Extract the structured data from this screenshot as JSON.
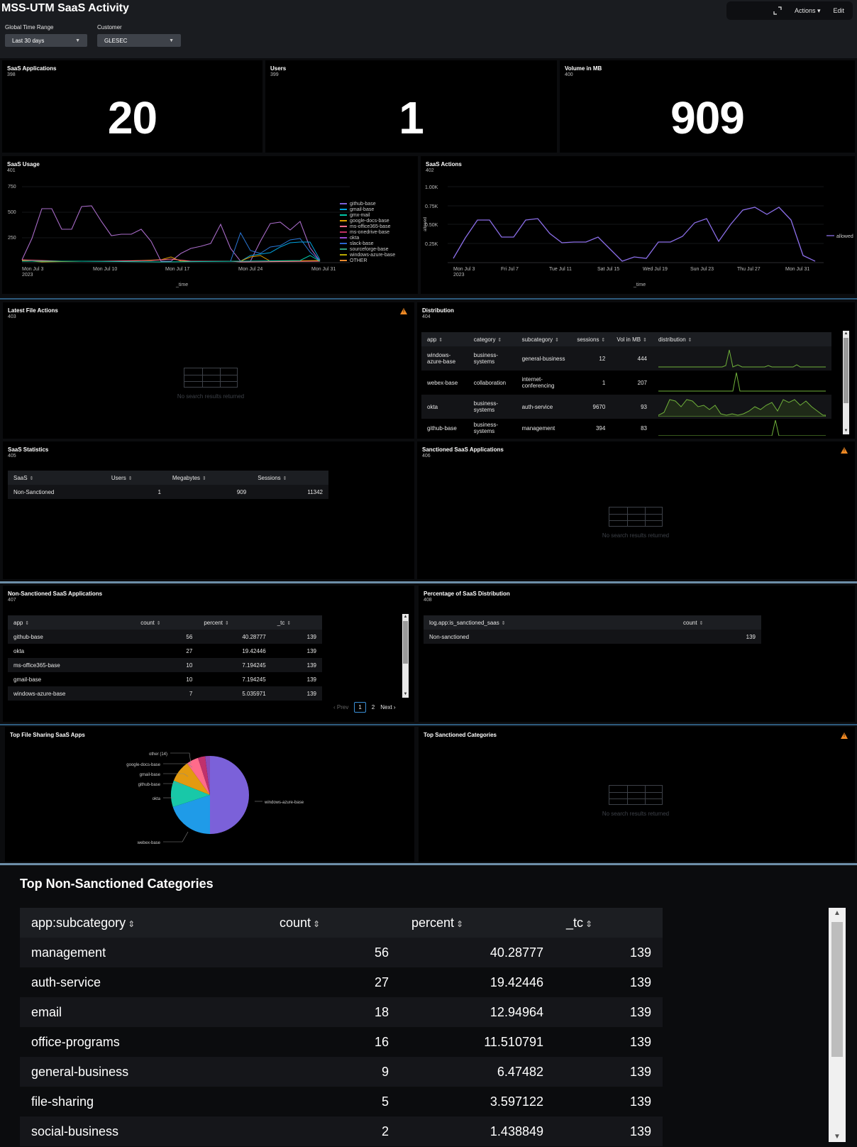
{
  "header": {
    "title": "MSS-UTM SaaS Activity",
    "actions_label": "Actions ▾",
    "edit_label": "Edit",
    "time_label": "Global Time Range",
    "time_value": "Last 30 days",
    "customer_label": "Customer",
    "customer_value": "GLESEC"
  },
  "singles": [
    {
      "title": "SaaS Applications",
      "id": "398",
      "value": "20"
    },
    {
      "title": "Users",
      "id": "399",
      "value": "1"
    },
    {
      "title": "Volume in MB",
      "id": "400",
      "value": "909"
    }
  ],
  "usage": {
    "title": "SaaS Usage",
    "id": "401",
    "y_ticks": [
      "750",
      "500",
      "250"
    ],
    "x_ticks": [
      "Mon Jul 3",
      "Mon Jul 10",
      "Mon Jul 17",
      "Mon Jul 24",
      "Mon Jul 31"
    ],
    "x_year": "2023",
    "x_label": "_time",
    "legend": [
      {
        "name": "github-base",
        "color": "#7b61d9"
      },
      {
        "name": "gmail-base",
        "color": "#00a4e0"
      },
      {
        "name": "gmx-mail",
        "color": "#00c6a8"
      },
      {
        "name": "google-docs-base",
        "color": "#e0a000"
      },
      {
        "name": "ms-office365-base",
        "color": "#ff6b8b"
      },
      {
        "name": "ms-onedrive-base",
        "color": "#c03060"
      },
      {
        "name": "okta",
        "color": "#9a4bd0"
      },
      {
        "name": "slack-base",
        "color": "#2a66d0"
      },
      {
        "name": "sourceforge-base",
        "color": "#30a080"
      },
      {
        "name": "windows-azure-base",
        "color": "#b8a800"
      },
      {
        "name": "OTHER",
        "color": "#e88a30"
      }
    ]
  },
  "actions_chart": {
    "title": "SaaS Actions",
    "id": "402",
    "y_ticks": [
      "1.00K",
      "0.75K",
      "0.50K",
      "0.25K"
    ],
    "y_label": "allowed",
    "x_ticks": [
      "Mon Jul 3",
      "Fri Jul 7",
      "Tue Jul 11",
      "Sat Jul 15",
      "Wed Jul 19",
      "Sun Jul 23",
      "Thu Jul 27",
      "Mon Jul 31"
    ],
    "x_year": "2023",
    "x_label": "_time",
    "legend_name": "allowed"
  },
  "file_actions": {
    "title": "Latest File Actions",
    "id": "403",
    "empty": "No search results returned"
  },
  "distribution": {
    "title": "Distribution",
    "id": "404",
    "columns": [
      "app",
      "category",
      "subcategory",
      "sessions",
      "Vol in MB",
      "distribution"
    ],
    "rows": [
      {
        "app": "windows-azure-base",
        "category": "business-systems",
        "subcategory": "general-business",
        "sessions": "12",
        "vol": "444"
      },
      {
        "app": "webex-base",
        "category": "collaboration",
        "subcategory": "internet-conferencing",
        "sessions": "1",
        "vol": "207"
      },
      {
        "app": "okta",
        "category": "business-systems",
        "subcategory": "auth-service",
        "sessions": "9670",
        "vol": "93"
      },
      {
        "app": "github-base",
        "category": "business-systems",
        "subcategory": "management",
        "sessions": "394",
        "vol": "83"
      }
    ]
  },
  "stats": {
    "title": "SaaS Statistics",
    "id": "405",
    "columns": [
      "SaaS",
      "Users",
      "Megabytes",
      "Sessions"
    ],
    "row": {
      "saas": "Non-Sanctioned",
      "users": "1",
      "mb": "909",
      "sessions": "11342"
    }
  },
  "sanctioned": {
    "title": "Sanctioned SaaS Applications",
    "id": "406",
    "empty": "No search results returned"
  },
  "nonsanctioned": {
    "title": "Non-Sanctioned SaaS Applications",
    "id": "407",
    "columns": [
      "app",
      "count",
      "percent",
      "_tc"
    ],
    "rows": [
      {
        "app": "github-base",
        "count": "56",
        "percent": "40.28777",
        "tc": "139"
      },
      {
        "app": "okta",
        "count": "27",
        "percent": "19.42446",
        "tc": "139"
      },
      {
        "app": "ms-office365-base",
        "count": "10",
        "percent": "7.194245",
        "tc": "139"
      },
      {
        "app": "gmail-base",
        "count": "10",
        "percent": "7.194245",
        "tc": "139"
      },
      {
        "app": "windows-azure-base",
        "count": "7",
        "percent": "5.035971",
        "tc": "139"
      }
    ],
    "pager": {
      "prev": "‹ Prev",
      "p1": "1",
      "p2": "2",
      "next": "Next ›"
    }
  },
  "percentage": {
    "title": "Percentage of SaaS Distribution",
    "id": "408",
    "columns": [
      "log.app:is_sanctioned_saas",
      "count"
    ],
    "row": {
      "name": "Non-sanctioned",
      "count": "139"
    }
  },
  "filesharing": {
    "title": "Top File Sharing SaaS Apps",
    "labels": [
      "other (14)",
      "google-docs-base",
      "gmail-base",
      "github-base",
      "okta",
      "webex-base",
      "windows-azure-base"
    ]
  },
  "chart_data": {
    "type": "pie",
    "categories": [
      "windows-azure-base",
      "webex-base",
      "okta",
      "github-base",
      "gmail-base",
      "google-docs-base",
      "other (14)"
    ],
    "values": [
      50,
      20,
      11,
      9,
      5,
      3,
      2
    ]
  },
  "topsanctioned": {
    "title": "Top Sanctioned Categories",
    "empty": "No search results returned"
  },
  "topnonsanctioned": {
    "title": "Top Non-Sanctioned Categories",
    "columns": [
      "app:subcategory",
      "count",
      "percent",
      "_tc"
    ],
    "rows": [
      {
        "cat": "management",
        "count": "56",
        "percent": "40.28777",
        "tc": "139"
      },
      {
        "cat": "auth-service",
        "count": "27",
        "percent": "19.42446",
        "tc": "139"
      },
      {
        "cat": "email",
        "count": "18",
        "percent": "12.94964",
        "tc": "139"
      },
      {
        "cat": "office-programs",
        "count": "16",
        "percent": "11.510791",
        "tc": "139"
      },
      {
        "cat": "general-business",
        "count": "9",
        "percent": "6.47482",
        "tc": "139"
      },
      {
        "cat": "file-sharing",
        "count": "5",
        "percent": "3.597122",
        "tc": "139"
      },
      {
        "cat": "social-business",
        "count": "2",
        "percent": "1.438849",
        "tc": "139"
      }
    ]
  }
}
